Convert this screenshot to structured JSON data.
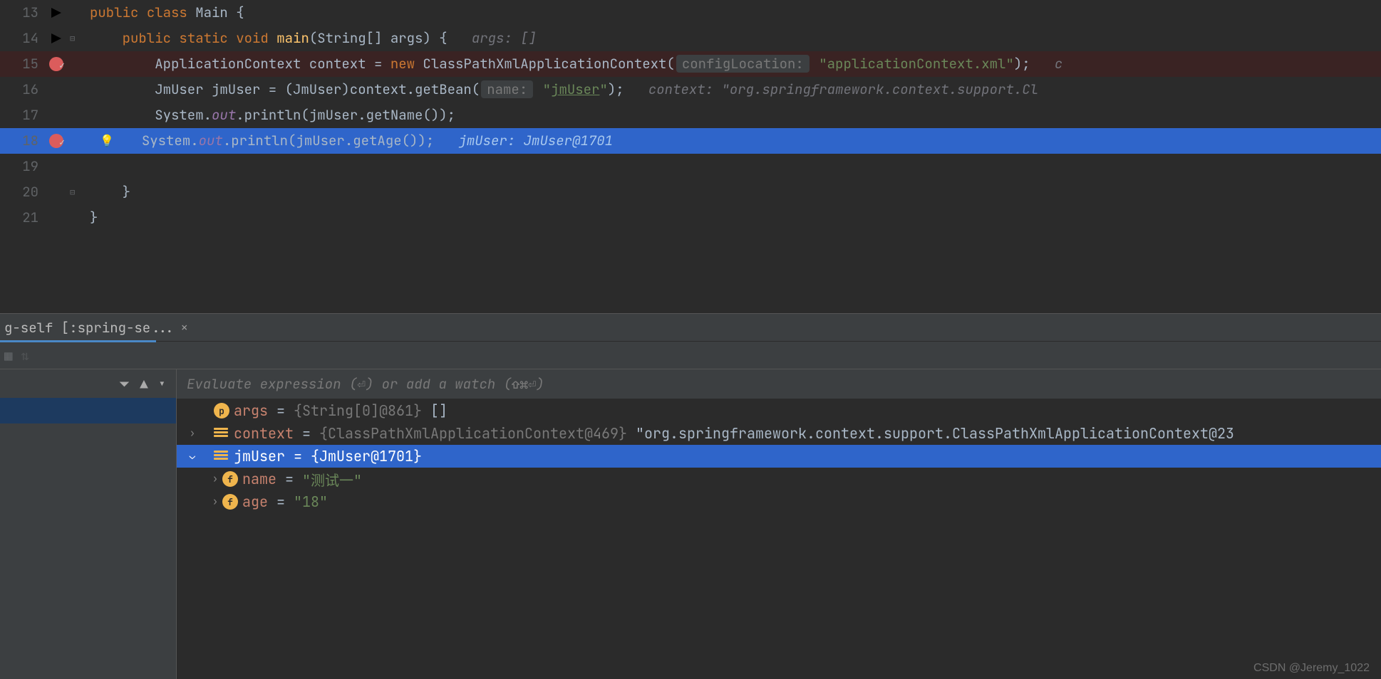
{
  "editor": {
    "lines": [
      {
        "num": "13",
        "run": true
      },
      {
        "num": "14",
        "run": true,
        "foldTop": true
      },
      {
        "num": "15",
        "bp": true
      },
      {
        "num": "16"
      },
      {
        "num": "17"
      },
      {
        "num": "18",
        "bp": true,
        "current": true,
        "bulb": true
      },
      {
        "num": "19"
      },
      {
        "num": "20",
        "foldBot": true
      },
      {
        "num": "21"
      }
    ],
    "code": {
      "l13": {
        "kw1": "public",
        "kw2": "class",
        "name": "Main",
        "brace": "{"
      },
      "l14": {
        "kw1": "public",
        "kw2": "static",
        "kw3": "void",
        "fn": "main",
        "sig": "(String[] args) {",
        "hint": "args: []"
      },
      "l15": {
        "t1": "ApplicationContext context = ",
        "kw": "new",
        "t2": " ClassPathXmlApplicationContext(",
        "ph": "configLocation:",
        "str": "\"applicationContext.xml\"",
        "t3": ");",
        "tail": "c"
      },
      "l16": {
        "t1": "JmUser jmUser = (JmUser)context.getBean(",
        "ph": "name:",
        "str": "\"",
        "u": "jmUser",
        "str2": "\"",
        "t2": ");",
        "hint": "context: \"org.springframework.context.support.Cl"
      },
      "l17": {
        "t1": "System.",
        "f": "out",
        "t2": ".println(jmUser.getName());"
      },
      "l18": {
        "t1": "System.",
        "f": "out",
        "t2": ".println(jmUser.getAge());",
        "hint": "jmUser: JmUser@1701"
      },
      "l20": {
        "b": "}"
      },
      "l21": {
        "b": "}"
      }
    }
  },
  "tab": {
    "label": "g-self [:spring-se...",
    "close": "×"
  },
  "eval": {
    "placeholder": "Evaluate expression (⏎) or add a watch (⇧⌘⏎)"
  },
  "vars": {
    "args": {
      "name": "args",
      "eq": " = ",
      "val": "{String[0]@861} ",
      "suffix": "[]"
    },
    "context": {
      "name": "context",
      "eq": " = ",
      "val": "{ClassPathXmlApplicationContext@469} ",
      "str": "\"org.springframework.context.support.ClassPathXmlApplicationContext@23"
    },
    "jmUser": {
      "name": "jmUser",
      "eq": " = ",
      "val": "{JmUser@1701}"
    },
    "nameF": {
      "name": "name",
      "eq": " = ",
      "str": "\"测试一\""
    },
    "ageF": {
      "name": "age",
      "eq": " = ",
      "str": "\"18\""
    },
    "badge": {
      "p": "p",
      "f": "f"
    }
  },
  "watermark": "CSDN @Jeremy_1022"
}
